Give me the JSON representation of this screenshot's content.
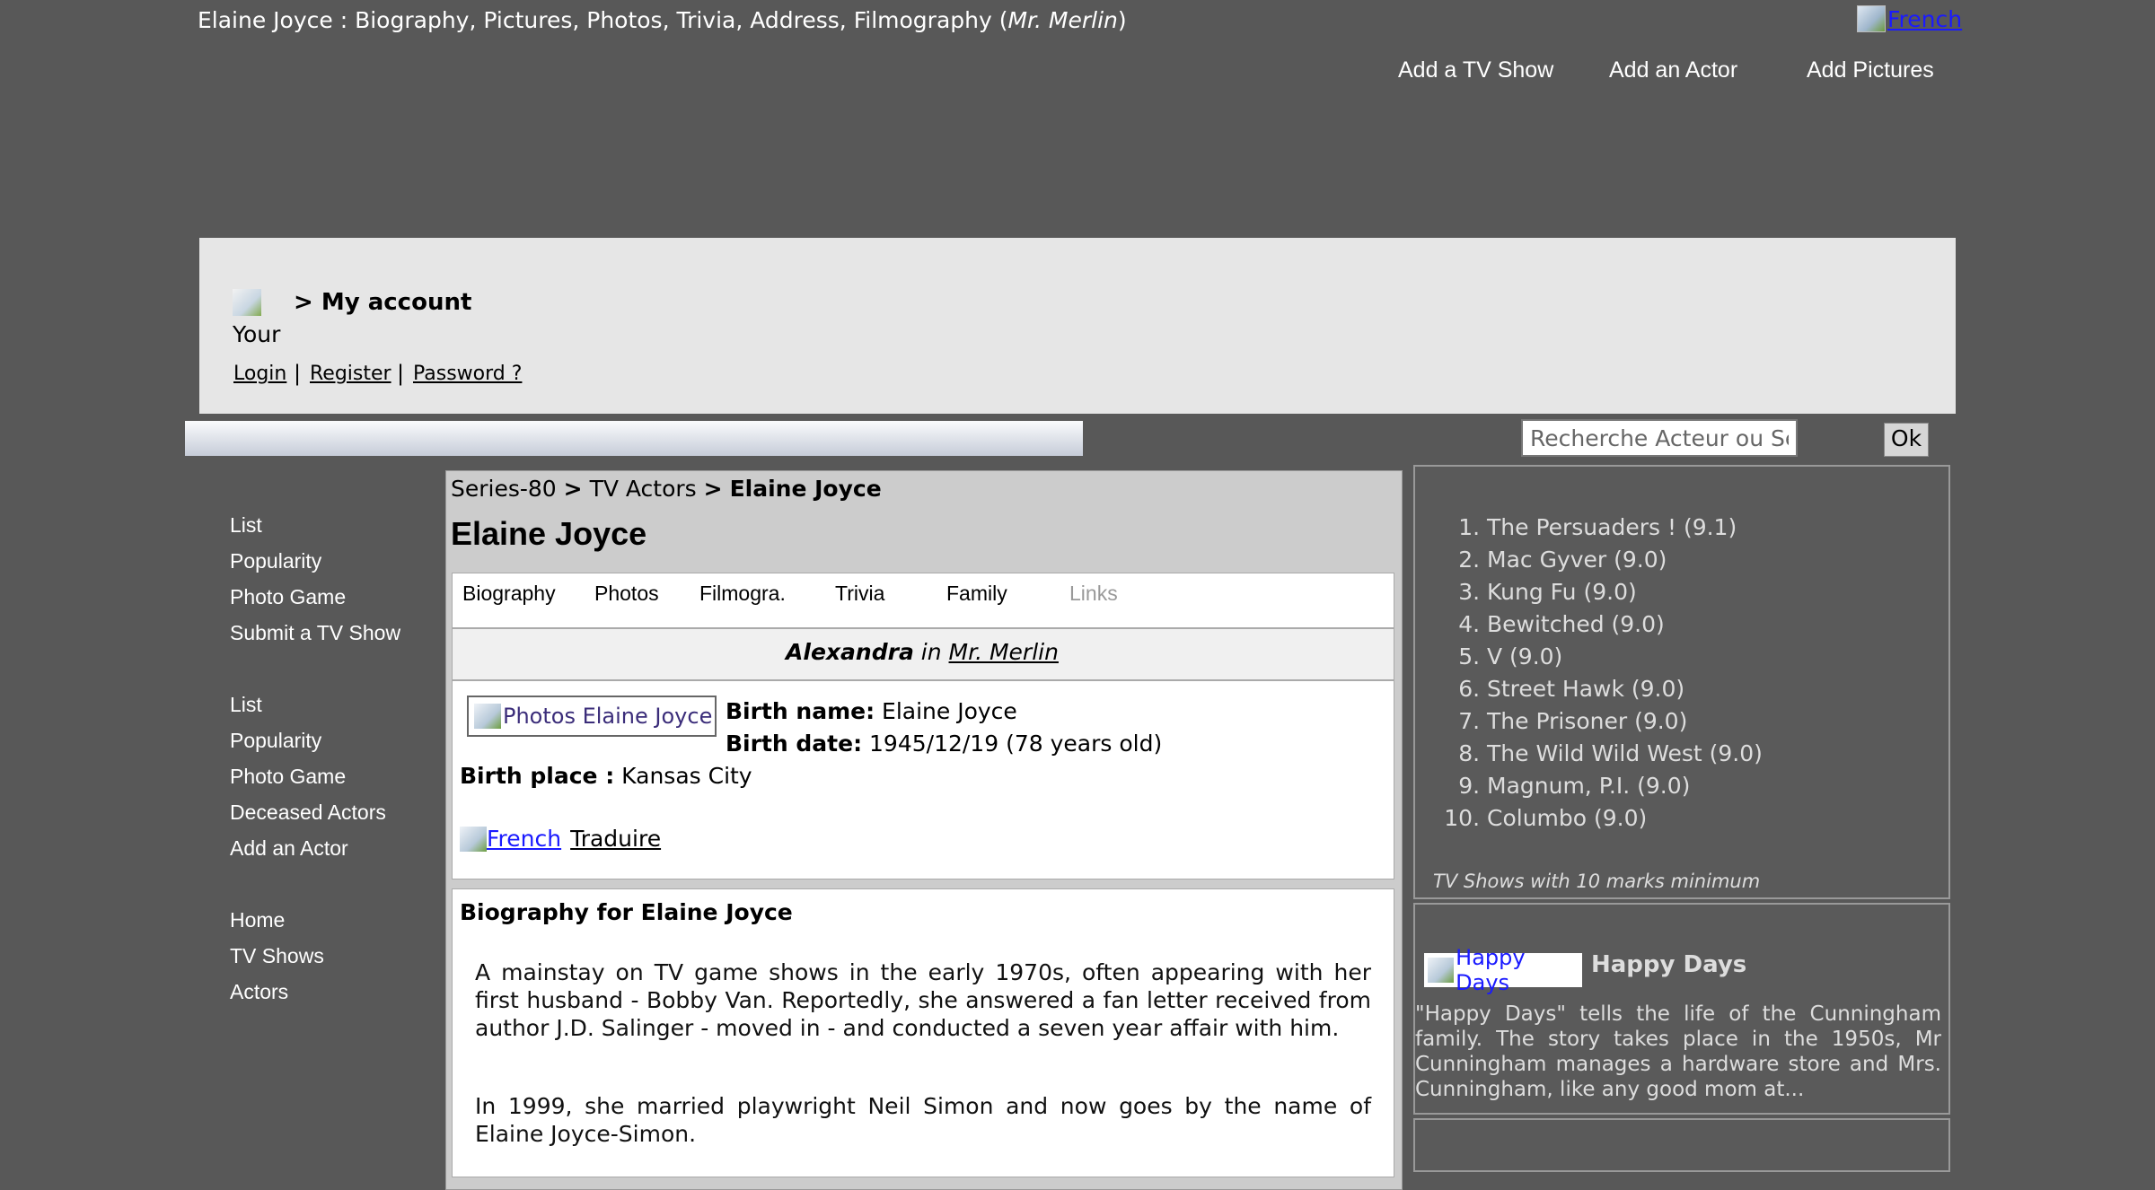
{
  "header": {
    "title_prefix": "Elaine Joyce : Biography, Pictures, Photos, Trivia, Address, Filmography (",
    "title_italic": "Mr. Merlin",
    "title_suffix": ")",
    "flag_alt": "French",
    "nav": [
      "Add a TV Show",
      "Add an Actor",
      "Add Pictures"
    ]
  },
  "account": {
    "avatar_alt": "Your",
    "title": "> My account",
    "links": [
      "Login",
      "Register",
      "Password ?"
    ],
    "separator": "|"
  },
  "search": {
    "placeholder": "Recherche Acteur ou Serie",
    "button": "Ok"
  },
  "sidebar": {
    "group1": [
      "List",
      "Popularity",
      "Photo Game",
      "Submit a TV Show"
    ],
    "group2": [
      "List",
      "Popularity",
      "Photo Game",
      "Deceased Actors",
      "Add an Actor"
    ],
    "group3": [
      "Home",
      "TV Shows",
      "Actors"
    ]
  },
  "main": {
    "breadcrumb": [
      "Series-80",
      "TV Actors",
      "Elaine Joyce"
    ],
    "breadcrumb_sep": ">",
    "actor_name": "Elaine Joyce",
    "tabs": [
      {
        "label": "Biography",
        "active": true
      },
      {
        "label": "Photos",
        "active": true
      },
      {
        "label": "Filmogra.",
        "active": true
      },
      {
        "label": "Trivia",
        "active": true
      },
      {
        "label": "Family",
        "active": true
      },
      {
        "label": "Links",
        "active": false
      }
    ],
    "role": {
      "character": "Alexandra",
      "connector": "in",
      "show": "Mr. Merlin"
    },
    "photo_alt": "Photos Elaine Joyce",
    "birth_name_label": "Birth name:",
    "birth_name": "Elaine Joyce",
    "birth_date_label": "Birth date:",
    "birth_date": "1945/12/19 (78 years old)",
    "birth_place_label": "Birth place :",
    "birth_place": "Kansas City",
    "translate_flag_alt": "French",
    "translate_link": "Traduire",
    "bio_title": "Biography for Elaine Joyce",
    "bio_paragraphs": [
      "A mainstay on TV game shows in the early 1970s, often appearing with her first husband - Bobby Van. Reportedly, she answered a fan letter received from author J.D. Salinger - moved in - and conducted a seven year affair with him.",
      "In 1999, she married playwright Neil Simon and now goes by the name of Elaine Joyce-Simon."
    ]
  },
  "ranking": {
    "items": [
      "The Persuaders ! (9.1)",
      "Mac Gyver (9.0)",
      "Kung Fu (9.0)",
      "Bewitched (9.0)",
      "V (9.0)",
      "Street Hawk (9.0)",
      "The Prisoner (9.0)",
      "The Wild Wild West (9.0)",
      "Magnum, P.I. (9.0)",
      "Columbo (9.0)"
    ],
    "note": "TV Shows with 10 marks minimum"
  },
  "featured": {
    "thumb_alt": "Happy Days",
    "title": "Happy Days",
    "description": "\"Happy Days\" tells the life of the Cunningham family. The story takes place in the 1950s, Mr Cunningham manages a hardware store and Mrs. Cunningham, like any good mom at..."
  },
  "colors": {
    "page_bg": "#585858",
    "account_bg": "#e6e6e6",
    "main_bg": "#cccccc",
    "link_blue": "#1a1aff"
  }
}
